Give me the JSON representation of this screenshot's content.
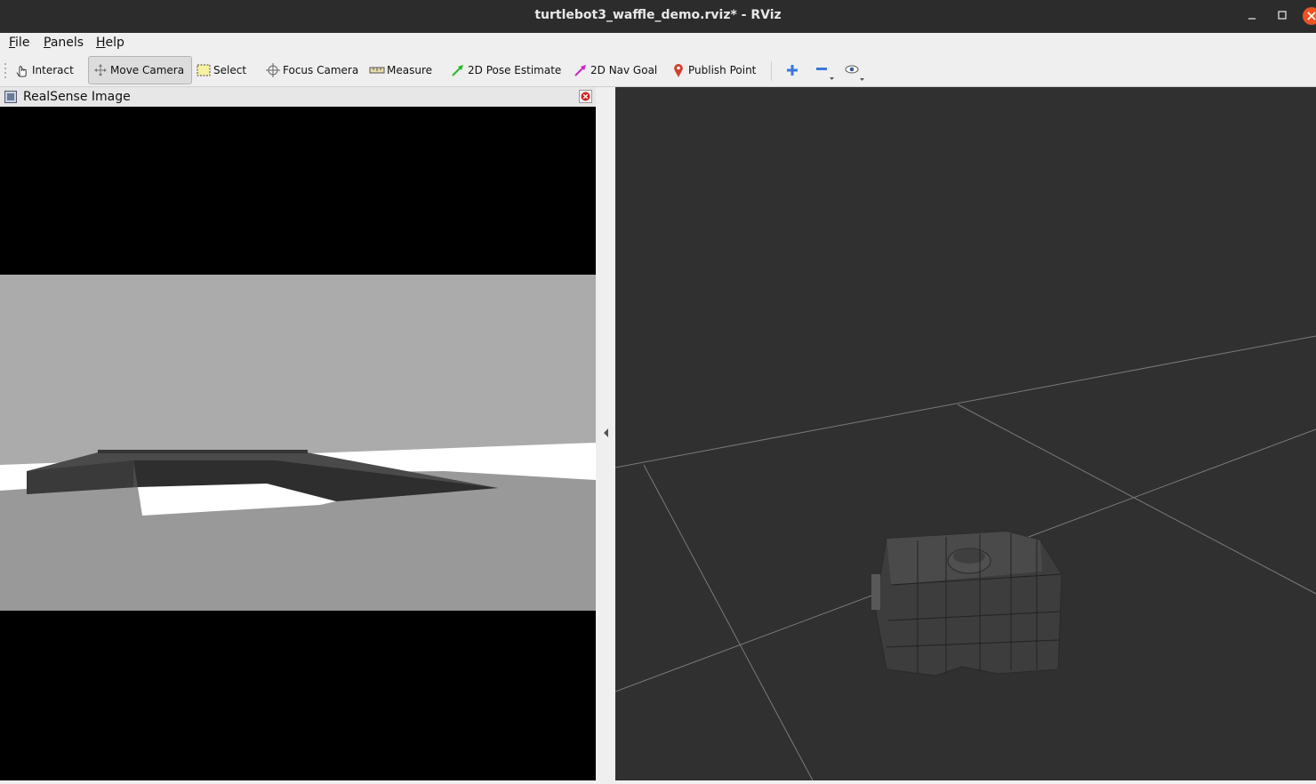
{
  "window": {
    "title": "turtlebot3_waffle_demo.rviz* - RViz",
    "buttons": [
      "minimize-icon",
      "maximize-icon",
      "close-icon"
    ]
  },
  "menu": [
    {
      "label": "File",
      "mnemonic": "F",
      "rest": "ile"
    },
    {
      "label": "Panels",
      "mnemonic": "P",
      "rest": "anels"
    },
    {
      "label": "Help",
      "mnemonic": "H",
      "rest": "elp"
    }
  ],
  "toolbar": {
    "tools": [
      {
        "label": "Interact",
        "icon": "hand-pointer-icon",
        "active": false
      },
      {
        "label": "Move Camera",
        "icon": "move-camera-icon",
        "active": true
      },
      {
        "label": "Select",
        "icon": "select-rect-icon",
        "active": false
      },
      {
        "label": "Focus Camera",
        "icon": "focus-crosshair-icon",
        "active": false
      },
      {
        "label": "Measure",
        "icon": "ruler-icon",
        "active": false
      },
      {
        "label": "2D Pose Estimate",
        "icon": "green-arrow-icon",
        "active": false
      },
      {
        "label": "2D Nav Goal",
        "icon": "magenta-arrow-icon",
        "active": false
      },
      {
        "label": "Publish Point",
        "icon": "map-pin-icon",
        "active": false
      }
    ],
    "extra_icons": [
      "add-tool-icon",
      "remove-tool-icon",
      "view-eye-icon"
    ]
  },
  "image_panel": {
    "title": "RealSense Image"
  },
  "colors": {
    "titlebar": "#2c2c2c",
    "close_button": "#e95420",
    "viewport_bg": "#303030",
    "point_cloud": "#e4e4e4",
    "pose_estimate": "#22bb22",
    "nav_goal": "#cc22cc",
    "publish_point": "#d0402a"
  }
}
